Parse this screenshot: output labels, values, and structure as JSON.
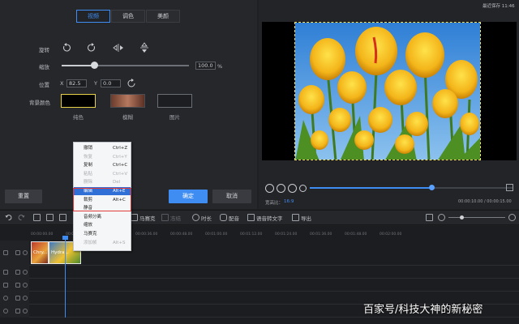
{
  "header": {
    "autosave_text": "最近保存 11:46"
  },
  "tabs": [
    {
      "label": "视频"
    },
    {
      "label": "调色"
    },
    {
      "label": "美颜"
    }
  ],
  "settings": {
    "rotate_label": "旋转",
    "scale_label": "缩放",
    "scale_value": "100.0",
    "scale_unit": "%",
    "scale_fraction": 0.25,
    "position_label": "位置",
    "x_label": "X",
    "x_value": "82.5",
    "y_label": "Y",
    "y_value": "0.0",
    "bg_label": "背景颜色",
    "bg_options": [
      {
        "label": "纯色"
      },
      {
        "label": "模糊"
      },
      {
        "label": "图片"
      }
    ],
    "reset_button": "重置",
    "ok_button": "确定",
    "cancel_button": "取消",
    "colors": {
      "accent": "#3f8cf2",
      "selected_swatch_border": "#e7d24a"
    }
  },
  "preview": {
    "aspect_label": "宽高比：",
    "aspect_value": "16:9",
    "time_display": "00:00:10.00 / 00:00:15.00",
    "progress_fraction": 0.6
  },
  "toolbar": {
    "items": [
      {
        "label": "马赛克"
      },
      {
        "label": "冻结"
      },
      {
        "label": "时长"
      },
      {
        "label": "配音"
      },
      {
        "label": "语音转文字"
      },
      {
        "label": "导出"
      }
    ]
  },
  "timeline": {
    "ticks": [
      "00:00:00.00",
      "00:00:12.00",
      "00:00:24.00",
      "00:00:36.00",
      "00:00:48.00",
      "00:01:00.00",
      "00:01:12.00",
      "00:01:24.00",
      "00:01:36.00",
      "00:01:48.00",
      "00:02:00.00"
    ],
    "clips": [
      {
        "label": "Chry..."
      },
      {
        "label": "Hydra..."
      }
    ]
  },
  "context_menu": {
    "items": [
      {
        "label": "撤销",
        "shortcut": "Ctrl+Z",
        "disabled": false
      },
      {
        "label": "恢复",
        "shortcut": "Ctrl+Y",
        "disabled": true
      },
      {
        "label": "复制",
        "shortcut": "Ctrl+C",
        "disabled": false
      },
      {
        "label": "粘贴",
        "shortcut": "Ctrl+V",
        "disabled": true
      },
      {
        "label": "删除",
        "shortcut": "Del",
        "disabled": true
      },
      {
        "label": "编辑",
        "shortcut": "Alt+E",
        "disabled": false,
        "highlighted": true
      },
      {
        "label": "裁剪",
        "shortcut": "Alt+C",
        "disabled": false
      },
      {
        "label": "静音",
        "shortcut": "",
        "disabled": false
      },
      {
        "label": "音频分离",
        "shortcut": "",
        "disabled": false
      },
      {
        "label": "缩放",
        "shortcut": "",
        "disabled": false
      },
      {
        "label": "马赛克",
        "shortcut": "",
        "disabled": false
      },
      {
        "label": "添加帧",
        "shortcut": "Alt+S",
        "disabled": true
      }
    ]
  },
  "watermark": "百家号/科技大神的新秘密"
}
